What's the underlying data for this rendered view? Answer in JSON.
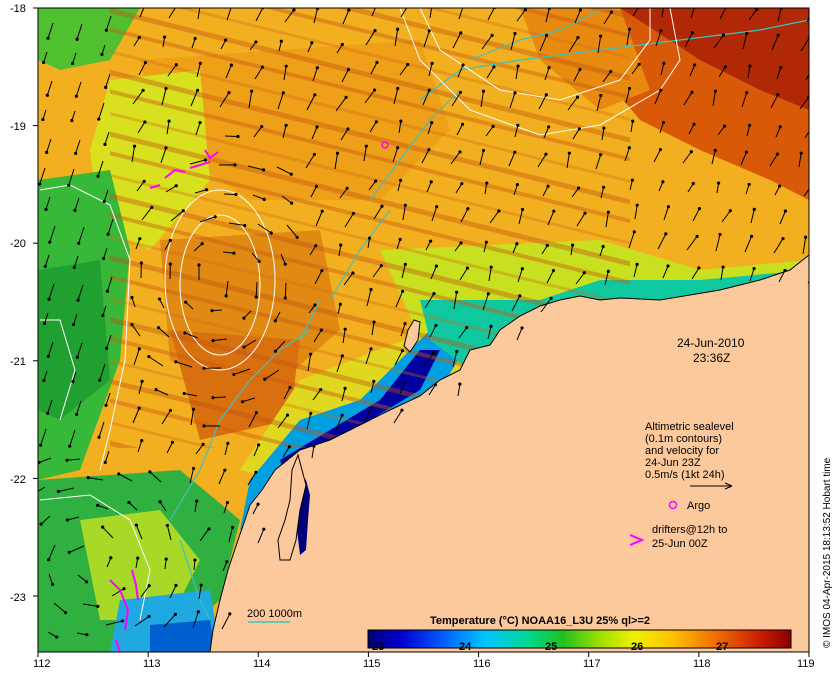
{
  "map": {
    "date_label": "24-Jun-2010",
    "time_label": "23:36Z",
    "x_ticks": [
      "112",
      "113",
      "114",
      "115",
      "116",
      "117",
      "118",
      "119"
    ],
    "y_ticks": [
      "-18",
      "-19",
      "-20",
      "-21",
      "-22",
      "-23"
    ],
    "scale_label": "200  1000m",
    "colorbar": {
      "title": "Temperature (°C) NOAA16_L3U 25% ql>=2",
      "ticks": [
        "23",
        "24",
        "25",
        "26",
        "27"
      ]
    },
    "legend": {
      "sealevel_lines": [
        "Altimetric sealevel",
        "(0.1m contours)",
        "and velocity for",
        "24-Jun 23Z",
        "0.5m/s (1kt 24h)"
      ],
      "argo_label": "Argo",
      "drifters_line1": "drifters@12h to",
      "drifters_line2": "25-Jun 00Z"
    },
    "credit": "© IMOS 04-Apr-2015 18:13:52 Hobart time",
    "colors": {
      "land": "#fcc99c",
      "argo": "#ff00ff",
      "drifter": "#ff00ff",
      "isobath": "#40c0c0",
      "contour": "#ffffff"
    }
  }
}
